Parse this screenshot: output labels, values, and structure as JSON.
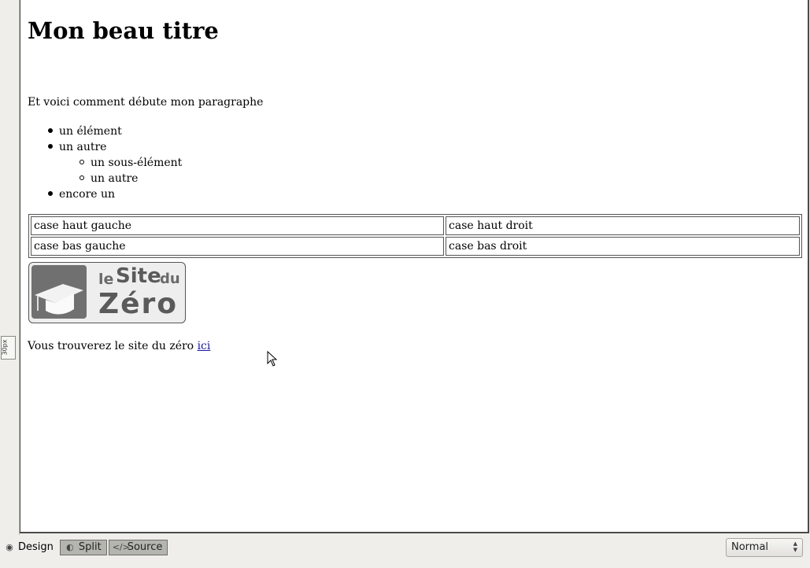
{
  "ruler": {
    "label": "30px"
  },
  "document": {
    "title": "Mon beau titre",
    "paragraph": "Et voici comment débute mon paragraphe",
    "list": [
      {
        "text": "un élément",
        "level": 1
      },
      {
        "text": "un autre",
        "level": 1
      },
      {
        "text": "un sous-élément",
        "level": 2
      },
      {
        "text": "un autre",
        "level": 2
      },
      {
        "text": "encore un",
        "level": 1
      }
    ],
    "table": [
      [
        "case haut gauche",
        "case haut droit"
      ],
      [
        "case bas gauche",
        "case bas droit"
      ]
    ],
    "logo": {
      "le": "le",
      "site": "Site",
      "du": "du",
      "zero": "Zéro"
    },
    "link_paragraph": {
      "prefix": "Vous trouverez le site du zéro ",
      "link_text": "ici"
    }
  },
  "view_tabs": [
    {
      "label": "Design",
      "icon": "eye-icon",
      "active": true
    },
    {
      "label": "Split",
      "icon": "split-view-icon",
      "active": false
    },
    {
      "label": "Source",
      "icon": "source-code-icon",
      "active": false
    }
  ],
  "zoom": {
    "value": "Normal"
  }
}
